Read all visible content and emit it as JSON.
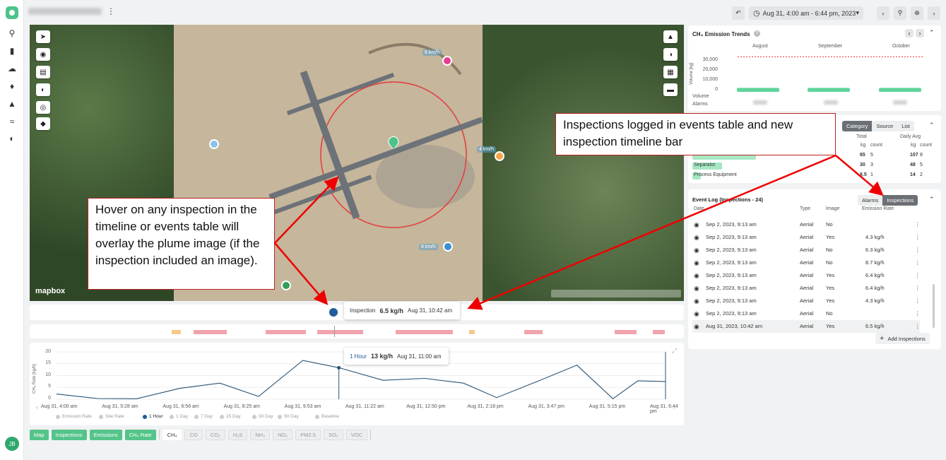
{
  "sidebar": {
    "avatar": "JB",
    "icons": [
      "logo-icon",
      "search-icon",
      "bar-chart-icon",
      "cloud-icon",
      "bell-icon",
      "flame-off-icon",
      "layers-icon",
      "gauge-icon"
    ]
  },
  "topbar": {
    "date_range": "Aug 31, 4:00 am - 6:44 pm, 2023"
  },
  "map": {
    "wind_labels": [
      "6 km/h",
      "4 km/h",
      "8 km/h"
    ],
    "brand": "mapbox",
    "markers": [
      {
        "color": "#e63e94"
      },
      {
        "color": "#8bc3e7"
      },
      {
        "color": "#f5a74b"
      },
      {
        "color": "#3b8fd3"
      },
      {
        "color": "#2f9f5a"
      }
    ]
  },
  "timeline": {
    "tooltip_label": "Inspection",
    "tooltip_value": "6.5 kg/h",
    "tooltip_time": "Aug 31, 10:42 am"
  },
  "chart_tooltip": {
    "label": "1 Hour",
    "value": "13 kg/h",
    "time": "Aug 31, 11:00 am"
  },
  "chart_data": {
    "type": "line",
    "ylabel": "CH₄ Rate [kg/h]",
    "ylim": [
      0,
      20
    ],
    "yticks": [
      "20",
      "15",
      "10",
      "5",
      "0"
    ],
    "x": [
      "4:00",
      "4:44",
      "5:28",
      "6:12",
      "6:56",
      "7:40",
      "8:25",
      "9:09",
      "9:53",
      "10:37",
      "11:22",
      "12:06",
      "12:50",
      "1:34",
      "2:18",
      "3:02",
      "3:47",
      "4:31",
      "5:15",
      "5:59",
      "6:44"
    ],
    "values": [
      2.2,
      0.3,
      0.2,
      4.6,
      6.8,
      1.2,
      16.4,
      13.3,
      8,
      8.8,
      6.8,
      0.7,
      7.2,
      14.4,
      0.2,
      7.8,
      7.5
    ],
    "xtick_labels": [
      "Aug 31, 4:00 am",
      "Aug 31, 5:28 am",
      "Aug 31, 6:56 am",
      "Aug 31, 8:25 am",
      "Aug 31, 9:53 am",
      "Aug 31, 11:22 am",
      "Aug 31, 12:50 pm",
      "Aug 31, 2:18 pm",
      "Aug 31, 3:47 pm",
      "Aug 31, 5:15 pm",
      "Aug 31, 6:44 pm"
    ],
    "legend": [
      "Emission Rate",
      "Site Rate",
      "1 Hour",
      "1 Day",
      "7 Day",
      "15 Day",
      "30 Day",
      "90 Day",
      "Baseline"
    ]
  },
  "bottombar": {
    "toggles": [
      "Map",
      "Inspections",
      "Emissions",
      "CH₄ Rate"
    ],
    "gases": [
      "CH₄",
      "CO",
      "CO₂",
      "H₂S",
      "NH₃",
      "NO₂",
      "PM2.5",
      "SO₂",
      "VOC"
    ]
  },
  "trends": {
    "title": "CH₄ Emission Trends",
    "months": [
      "August",
      "September",
      "October"
    ],
    "yticks": [
      "30,000",
      "20,000",
      "10,000",
      "0"
    ],
    "ylabel": "Volume [kg]",
    "row_labels": [
      "Volume",
      "Alarms"
    ],
    "chart_data": {
      "type": "bar",
      "categories": [
        "August",
        "September",
        "October"
      ],
      "values": [
        3500,
        3500,
        3500
      ],
      "threshold": 31000,
      "ylim": [
        0,
        35000
      ]
    }
  },
  "breakdown": {
    "tabs": [
      "Category",
      "Source",
      "List"
    ],
    "header_total": "Total",
    "header_daily": "Daily Avg",
    "sub": [
      "kg",
      "count",
      "kg",
      "count"
    ],
    "rows": [
      {
        "name": "",
        "total_kg": "65",
        "count": "5",
        "daily_kg": "107",
        "daily_count": "8",
        "pct": 0.75
      },
      {
        "name": "Separator",
        "total_kg": "30",
        "count": "3",
        "daily_kg": "48",
        "daily_count": "5",
        "pct": 0.35
      },
      {
        "name": "Process Equipment",
        "total_kg": "8.5",
        "count": "1",
        "daily_kg": "14",
        "daily_count": "2",
        "pct": 0.1
      }
    ]
  },
  "eventlog": {
    "title": "Event Log (Inspections - 24)",
    "tabs": [
      "Alarms",
      "Inspections"
    ],
    "cols": [
      "Date",
      "Type",
      "Image",
      "Emission Rate"
    ],
    "rows": [
      {
        "date": "Sep 2, 2023, 9:13 am",
        "type": "Aerial",
        "image": "No",
        "rate": ""
      },
      {
        "date": "Sep 2, 2023, 9:13 am",
        "type": "Aerial",
        "image": "Yes",
        "rate": "4.3 kg/h"
      },
      {
        "date": "Sep 2, 2023, 9:13 am",
        "type": "Aerial",
        "image": "No",
        "rate": "6.3 kg/h"
      },
      {
        "date": "Sep 2, 2023, 9:13 am",
        "type": "Aerial",
        "image": "No",
        "rate": "8.7 kg/h"
      },
      {
        "date": "Sep 2, 2023, 9:13 am",
        "type": "Aerial",
        "image": "Yes",
        "rate": "6.4 kg/h"
      },
      {
        "date": "Sep 2, 2023, 9:13 am",
        "type": "Aerial",
        "image": "Yes",
        "rate": "6.4 kg/h"
      },
      {
        "date": "Sep 2, 2023, 9:13 am",
        "type": "Aerial",
        "image": "Yes",
        "rate": "4.3 kg/h"
      },
      {
        "date": "Sep 2, 2023, 9:13 am",
        "type": "Aerial",
        "image": "No",
        "rate": ""
      },
      {
        "date": "Aug 31, 2023, 10:42 am",
        "type": "Aerial",
        "image": "Yes",
        "rate": "6.5 kg/h"
      }
    ],
    "add_label": "Add Inspections"
  },
  "annotations": {
    "right": "Inspections logged in events table and new inspection timeline bar",
    "left": "Hover on any inspection in the timeline or events table will overlay the plume image (if the inspection included an image)."
  }
}
